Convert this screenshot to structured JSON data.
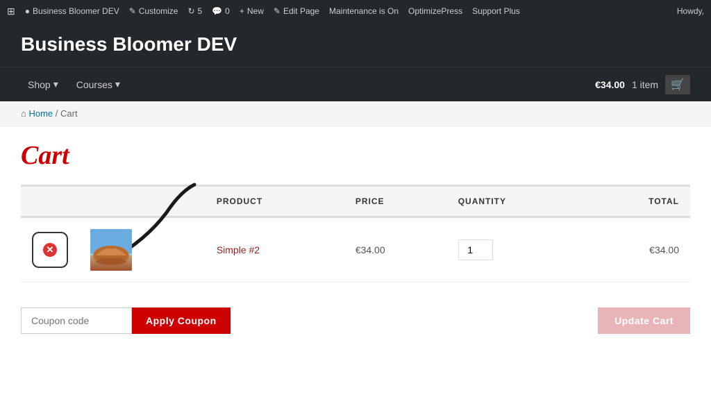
{
  "adminBar": {
    "items": [
      {
        "id": "wp-logo",
        "label": "",
        "icon": "⊞"
      },
      {
        "id": "site-name",
        "label": "Business Bloomer DEV",
        "icon": "●"
      },
      {
        "id": "customize",
        "label": "Customize",
        "icon": "✎"
      },
      {
        "id": "updates",
        "label": "5",
        "icon": "↻"
      },
      {
        "id": "comments",
        "label": "0",
        "icon": "💬"
      },
      {
        "id": "new",
        "label": "New",
        "icon": "+"
      },
      {
        "id": "edit-page",
        "label": "Edit Page",
        "icon": "✎"
      },
      {
        "id": "maintenance",
        "label": "Maintenance is On",
        "icon": ""
      },
      {
        "id": "optimizepress",
        "label": "OptimizePress",
        "icon": ""
      },
      {
        "id": "support-plus",
        "label": "Support Plus",
        "icon": ""
      }
    ],
    "howdy": "Howdy,"
  },
  "siteHeader": {
    "title": "Business Bloomer DEV"
  },
  "nav": {
    "items": [
      {
        "label": "Shop",
        "hasDropdown": true
      },
      {
        "label": "Courses",
        "hasDropdown": true
      }
    ],
    "cart": {
      "price": "€34.00",
      "itemCount": "1 item"
    }
  },
  "breadcrumb": {
    "homeLabel": "Home",
    "separator": "/",
    "current": "Cart"
  },
  "page": {
    "title": "Cart",
    "table": {
      "headers": {
        "remove": "",
        "product": "PRODUCT",
        "price": "PRICE",
        "quantity": "QUANTITY",
        "total": "TOTAL"
      },
      "rows": [
        {
          "productName": "Simple #2",
          "price": "€34.00",
          "quantity": "1",
          "total": "€34.00"
        }
      ]
    },
    "coupon": {
      "placeholder": "Coupon code",
      "buttonLabel": "Apply Coupon"
    },
    "updateCartLabel": "Update Cart"
  }
}
